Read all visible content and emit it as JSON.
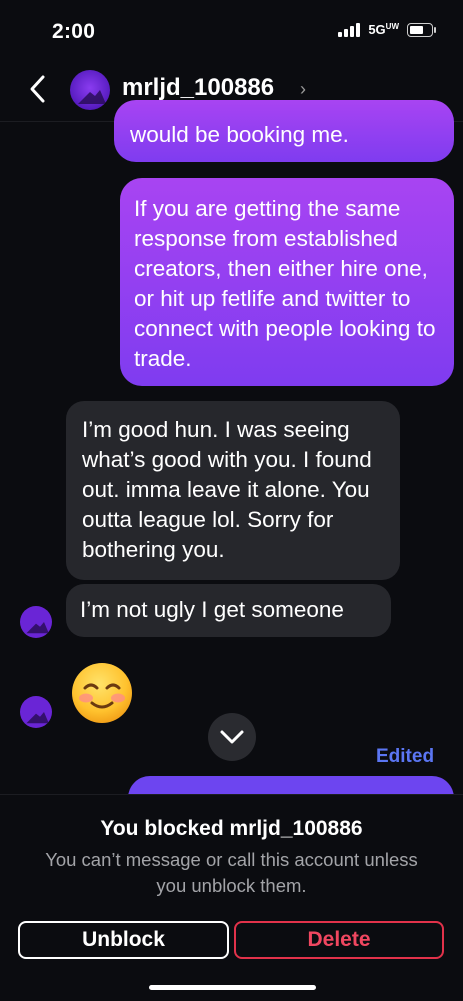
{
  "status_bar": {
    "time": "2:00",
    "network": "5G",
    "network_suffix": "UW"
  },
  "header": {
    "username": "mrljd_100886",
    "back_icon": "chevron-left-icon",
    "chevron": "›"
  },
  "messages": [
    {
      "direction": "outgoing",
      "text": "would be booking me."
    },
    {
      "direction": "outgoing",
      "text": "If you are getting the same response from established creators, then either hire one, or hit up fetlife and twitter to connect with people looking to trade."
    },
    {
      "direction": "incoming",
      "text": "I’m good hun. I was seeing what’s good with you. I found out. imma leave it alone. You outta league lol. Sorry for bothering you."
    },
    {
      "direction": "incoming",
      "text": "I’m not ugly I get someone"
    },
    {
      "direction": "incoming",
      "emoji": "smiling-face-with-blush"
    }
  ],
  "edited_label": "Edited",
  "footer": {
    "title": "You blocked mrljd_100886",
    "subtitle": "You can’t message or call this account unless you unblock them.",
    "unblock_label": "Unblock",
    "delete_label": "Delete"
  },
  "colors": {
    "background": "#0b0c10",
    "outgoing_bubble": "#9a40f2",
    "incoming_bubble": "#26272c",
    "edited": "#5b76f3",
    "delete": "#f04760"
  }
}
